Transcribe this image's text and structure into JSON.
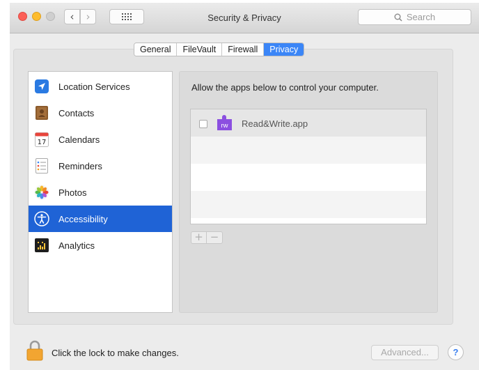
{
  "window": {
    "title": "Security & Privacy",
    "search_placeholder": "Search",
    "back_glyph": "‹",
    "forward_glyph": "›"
  },
  "tabs": [
    {
      "label": "General",
      "active": false
    },
    {
      "label": "FileVault",
      "active": false
    },
    {
      "label": "Firewall",
      "active": false
    },
    {
      "label": "Privacy",
      "active": true
    }
  ],
  "sidebar": {
    "items": [
      {
        "label": "Location Services",
        "icon": "location-arrow-icon",
        "selected": false
      },
      {
        "label": "Contacts",
        "icon": "contacts-book-icon",
        "selected": false
      },
      {
        "label": "Calendars",
        "icon": "calendar-icon",
        "selected": false
      },
      {
        "label": "Reminders",
        "icon": "reminders-list-icon",
        "selected": false
      },
      {
        "label": "Photos",
        "icon": "photos-flower-icon",
        "selected": false
      },
      {
        "label": "Accessibility",
        "icon": "accessibility-person-icon",
        "selected": true
      },
      {
        "label": "Analytics",
        "icon": "analytics-grid-icon",
        "selected": false
      }
    ],
    "calendar_day": "17"
  },
  "main": {
    "description": "Allow the apps below to control your computer.",
    "apps": [
      {
        "name": "Read&Write.app",
        "checked": false,
        "icon": "read-write-puzzle-icon",
        "icon_text": "rw"
      }
    ],
    "plus_label": "+",
    "minus_label": "−"
  },
  "footer": {
    "lock_text": "Click the lock to make changes.",
    "advanced_label": "Advanced...",
    "help_label": "?"
  },
  "colors": {
    "accent": "#3b86f7",
    "selection": "#1f63d6",
    "app_icon": "#8b4fe0"
  }
}
